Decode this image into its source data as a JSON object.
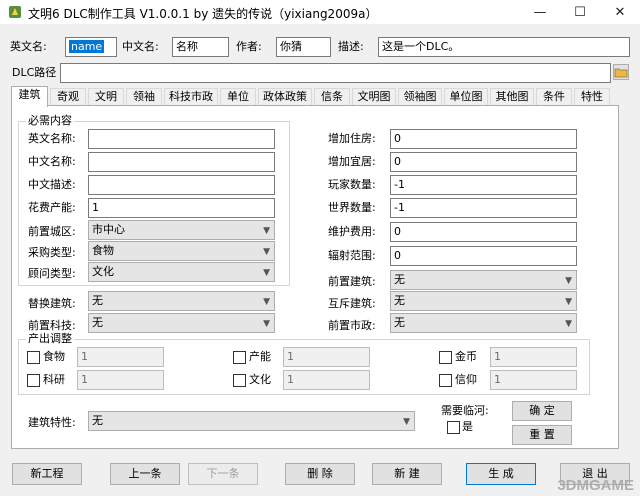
{
  "window": {
    "title": "文明6 DLC制作工具 V1.0.0.1 by 遗失的传说（yixiang2009a）",
    "minimize": "—",
    "maximize": "☐",
    "close": "✕"
  },
  "header": {
    "en_name_label": "英文名:",
    "en_name_value": "name",
    "cn_name_label": "中文名:",
    "cn_name_value": "名称",
    "author_label": "作者:",
    "author_value": "你猜",
    "desc_label": "描述:",
    "desc_value": "这是一个DLC。",
    "dlc_path_label": "DLC路径",
    "dlc_path_value": ""
  },
  "tabs": [
    "建筑",
    "奇观",
    "文明",
    "领袖",
    "科技市政",
    "单位",
    "政体政策",
    "信条",
    "文明图",
    "领袖图",
    "单位图",
    "其他图",
    "条件",
    "特性"
  ],
  "form": {
    "required_group": "必需内容",
    "en_name_label": "英文名称:",
    "en_name_value": "",
    "cn_name_label": "中文名称:",
    "cn_name_value": "",
    "cn_desc_label": "中文描述:",
    "cn_desc_value": "",
    "cost_label": "花费产能:",
    "cost_value": "1",
    "prereq_district_label": "前置城区:",
    "prereq_district_value": "市中心",
    "purchase_type_label": "采购类型:",
    "purchase_type_value": "食物",
    "advisor_type_label": "顾问类型:",
    "advisor_type_value": "文化",
    "housing_label": "增加住房:",
    "housing_value": "0",
    "amenity_label": "增加宜居:",
    "amenity_value": "0",
    "player_count_label": "玩家数量:",
    "player_count_value": "-1",
    "world_count_label": "世界数量:",
    "world_count_value": "-1",
    "maintenance_label": "维护费用:",
    "maintenance_value": "0",
    "radius_label": "辐射范围:",
    "radius_value": "0",
    "prereq_building_label": "前置建筑:",
    "prereq_building_value": "无",
    "replace_building_label": "替换建筑:",
    "replace_building_value": "无",
    "exclusive_building_label": "互斥建筑:",
    "exclusive_building_value": "无",
    "prereq_tech_label": "前置科技:",
    "prereq_tech_value": "无",
    "prereq_civic_label": "前置市政:",
    "prereq_civic_value": "无",
    "yield_group": "产出调整",
    "yields": [
      {
        "label": "食物",
        "value": "1"
      },
      {
        "label": "产能",
        "value": "1"
      },
      {
        "label": "金币",
        "value": "1"
      },
      {
        "label": "科研",
        "value": "1"
      },
      {
        "label": "文化",
        "value": "1"
      },
      {
        "label": "信仰",
        "value": "1"
      }
    ],
    "trait_label": "建筑特性:",
    "trait_value": "无",
    "river_label": "需要临河:",
    "river_yes": "是",
    "confirm_button": "确 定",
    "reset_button": "重 置"
  },
  "bottom": {
    "new_project": "新工程",
    "prev": "上一条",
    "next": "下一条",
    "delete": "删 除",
    "new": "新 建",
    "generate": "生 成",
    "exit": "退 出"
  },
  "watermark": "3DMGAME"
}
